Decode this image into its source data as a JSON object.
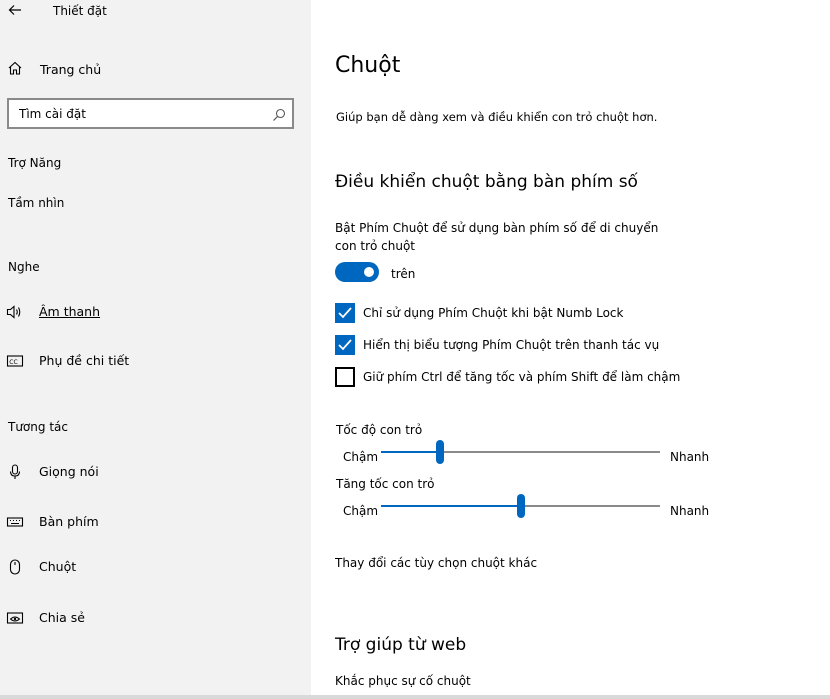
{
  "window": {
    "title": "Thiết đặt"
  },
  "sidebar": {
    "home_label": "Trang chủ",
    "search_placeholder": "Tìm cài đặt",
    "category": "Trợ Năng",
    "groups": {
      "vision": "Tầm nhìn",
      "hearing": "Nghe",
      "interaction": "Tương tác"
    },
    "items": {
      "audio": "Âm thanh",
      "captions": "Phụ đề chi tiết",
      "speech": "Giọng nói",
      "keyboard": "Bàn phím",
      "mouse": "Chuột",
      "eye_control": "Chia sẻ"
    }
  },
  "main": {
    "title": "Chuột",
    "description": "Giúp bạn dễ dàng xem và điều khiển con trỏ chuột hơn.",
    "keypad_section": {
      "title": "Điều khiển chuột bằng bàn phím số",
      "toggle_description": "Bật Phím Chuột để sử dụng bàn phím số để di chuyển con trỏ chuột",
      "toggle_on": true,
      "toggle_state_label": "trên",
      "checkboxes": [
        {
          "label": "Chỉ sử dụng Phím Chuột khi bật Numb Lock",
          "checked": true
        },
        {
          "label": "Hiển thị biểu tượng Phím Chuột trên thanh tác vụ",
          "checked": true
        },
        {
          "label": "Giữ phím Ctrl để tăng tốc và phím Shift để làm chậm",
          "checked": false
        }
      ]
    },
    "sliders": [
      {
        "title": "Tốc độ con trỏ",
        "min_label": "Chậm",
        "max_label": "Nhanh",
        "value": 0.21
      },
      {
        "title": "Tăng tốc con trỏ",
        "min_label": "Chậm",
        "max_label": "Nhanh",
        "value": 0.5
      }
    ],
    "more_options_link": "Thay đổi các tùy chọn chuột khác",
    "help_section": {
      "title": "Trợ giúp từ web",
      "link": "Khắc phục sự cố chuột"
    }
  },
  "colors": {
    "accent": "#0067c0",
    "sidebar_bg": "#f2f2f2"
  }
}
